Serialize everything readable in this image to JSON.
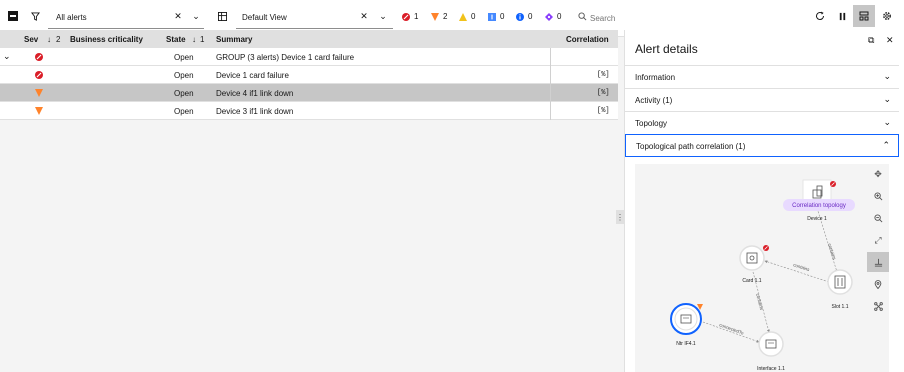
{
  "toolbar": {
    "filter_value": "All alerts",
    "view_value": "Default View",
    "search_placeholder": "Search",
    "severity_counts": [
      {
        "name": "critical",
        "count": "1",
        "color": "#da1e28"
      },
      {
        "name": "major",
        "count": "2",
        "color": "#ff832b"
      },
      {
        "name": "minor",
        "count": "0",
        "color": "#f1c21b"
      },
      {
        "name": "warning",
        "count": "0",
        "color": "#4589ff"
      },
      {
        "name": "information",
        "count": "0",
        "color": "#0f62fe"
      },
      {
        "name": "indeterminate",
        "count": "0",
        "color": "#8a3ffc"
      }
    ]
  },
  "grid": {
    "headers": {
      "sev": "Sev",
      "sev_sort": "2",
      "business": "Business criticality",
      "state": "State",
      "state_sort": "1",
      "summary": "Summary",
      "correlation": "Correlation"
    },
    "rows": [
      {
        "state": "Open",
        "summary": "GROUP (3 alerts) Device 1 card failure",
        "severity": "critical",
        "corr": ""
      },
      {
        "state": "Open",
        "summary": "Device 1 card failure",
        "severity": "critical",
        "corr": "[%]"
      },
      {
        "state": "Open",
        "summary": "Device 4 if1 link down",
        "severity": "major",
        "corr": "[%]"
      },
      {
        "state": "Open",
        "summary": "Device 3 if1 link down",
        "severity": "major",
        "corr": "[%]"
      }
    ]
  },
  "details": {
    "title": "Alert details",
    "sections": [
      {
        "label": "Information",
        "open": false
      },
      {
        "label": "Activity (1)",
        "open": false
      },
      {
        "label": "Topology",
        "open": false
      },
      {
        "label": "Topological path correlation (1)",
        "open": true
      }
    ]
  },
  "topology": {
    "nodes": {
      "device1": "Device 1",
      "card": "Card 1.1",
      "slot": "Slot 1.1",
      "ntr": "Ntr IF4.1",
      "iface": "Interface 1.1"
    },
    "tooltip": "Correlation topology",
    "edges": {
      "d1_slot": "contains",
      "slot_card": "contains",
      "card_iface": "contains",
      "ntr_iface": "connectedTo"
    }
  }
}
